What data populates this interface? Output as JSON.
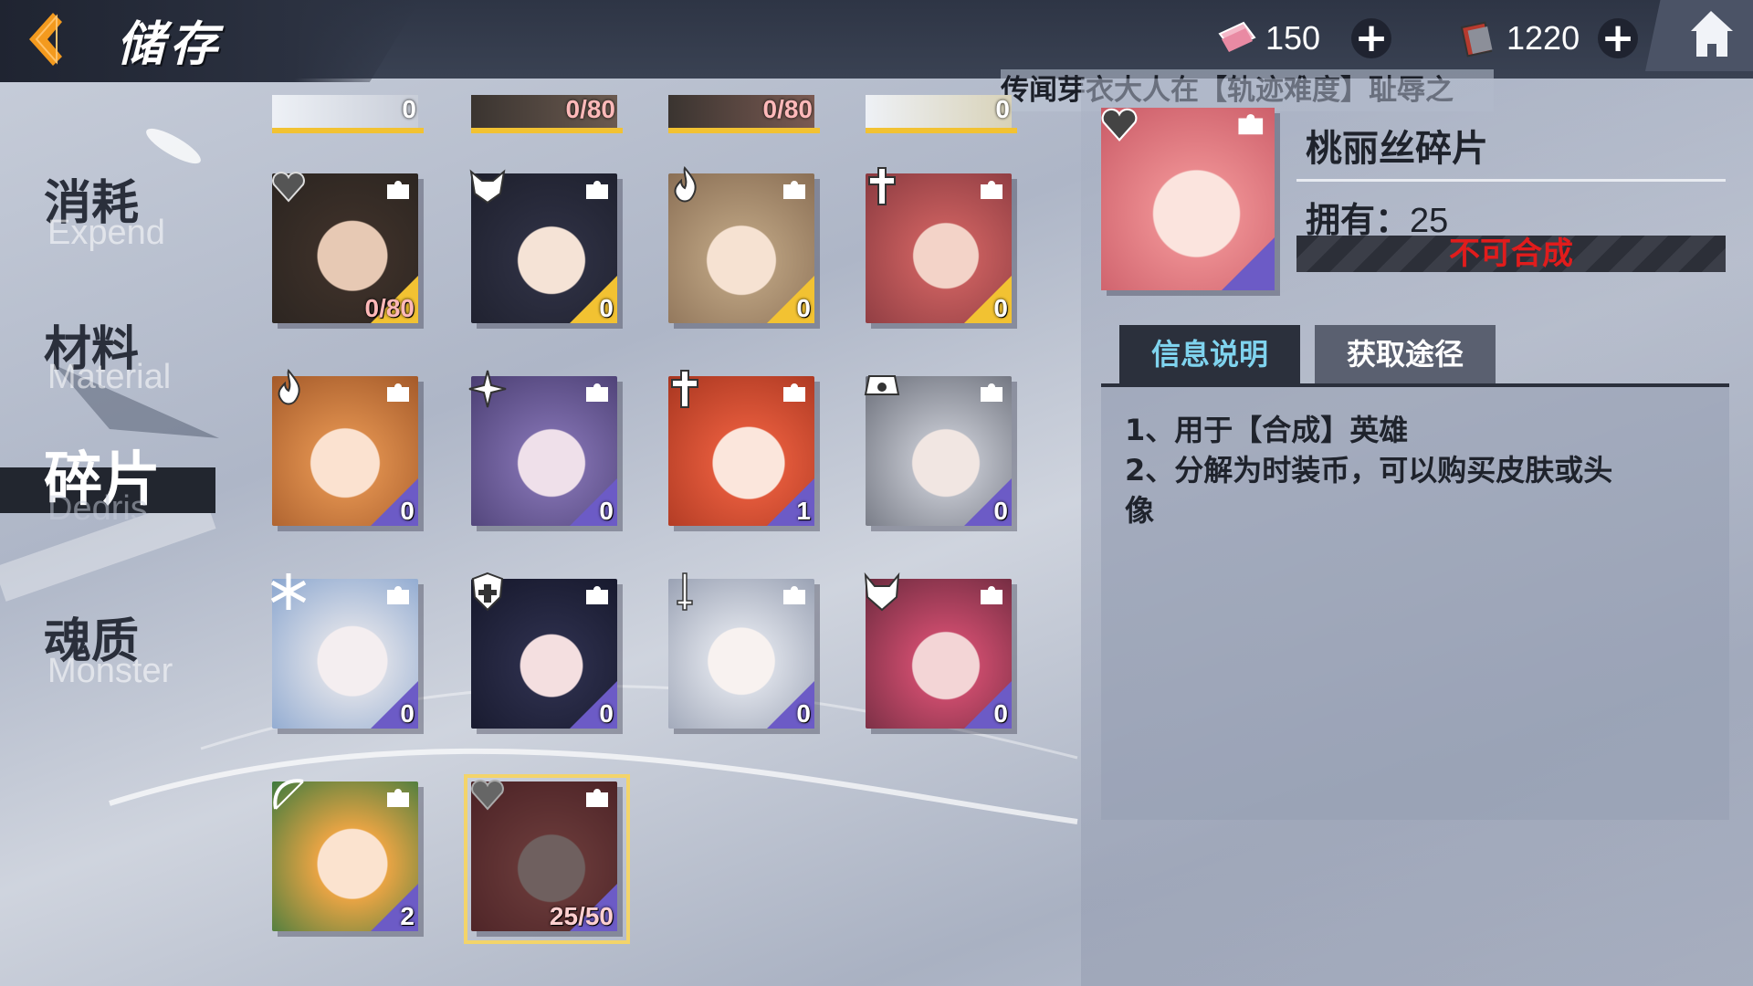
{
  "header": {
    "title": "储存",
    "currency_1": {
      "icon": "ticket-icon",
      "value": "150"
    },
    "currency_2": {
      "icon": "book-icon",
      "value": "1220"
    },
    "plus": "+"
  },
  "ticker": "传闻芽衣大人在【轨迹难度】耻辱之",
  "nav": [
    {
      "cn": "消耗",
      "en": "Expend"
    },
    {
      "cn": "材料",
      "en": "Material"
    },
    {
      "cn": "碎片",
      "en": "Dedris"
    },
    {
      "cn": "魂质",
      "en": "Monster"
    }
  ],
  "grid": {
    "partial_row": [
      "0",
      "0/80",
      "0/80",
      "0"
    ],
    "rows": [
      [
        "0/80",
        "0",
        "0",
        "0"
      ],
      [
        "0",
        "0",
        "1",
        "0"
      ],
      [
        "0",
        "0",
        "0",
        "0"
      ],
      [
        "2",
        "25/50"
      ]
    ]
  },
  "detail": {
    "name": "桃丽丝碎片",
    "owned_label": "拥有：",
    "owned_value": "25",
    "status": "不可合成",
    "tab_info": "信息说明",
    "tab_source": "获取途径",
    "desc_1": "1、用于【合成】英雄",
    "desc_2": "2、分解为时装币，可以购买皮肤或头",
    "desc_3": "像"
  },
  "colors": {
    "tier_gold": "#f2c232",
    "tier_purple": "#6c5bc6",
    "status_red": "#e11c1c",
    "tab_active_text": "#7fd3ee"
  }
}
